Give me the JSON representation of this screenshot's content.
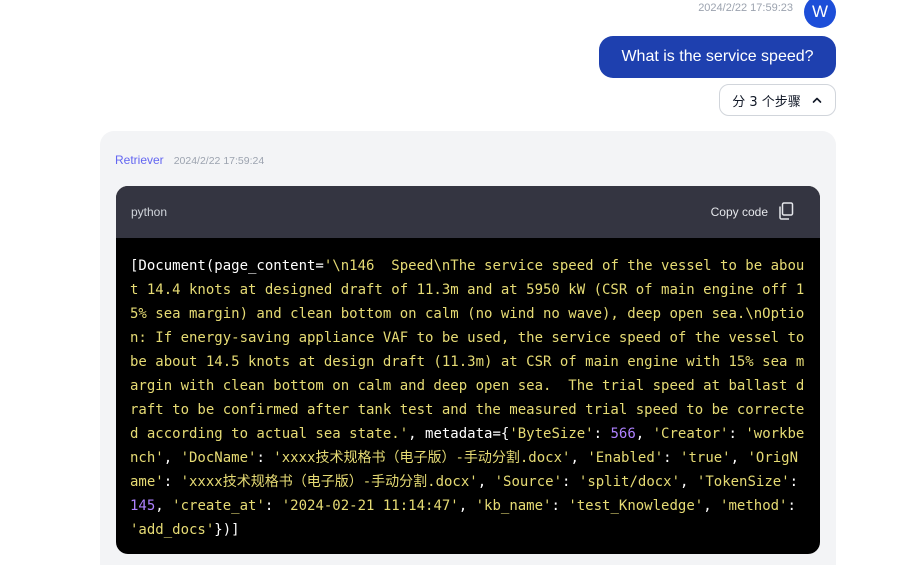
{
  "user_message": {
    "timestamp": "2024/2/22 17:59:23",
    "avatar_letter": "W",
    "text": "What is the service speed?",
    "steps_label": "分 3 个步骤"
  },
  "retriever": {
    "label": "Retriever",
    "timestamp": "2024/2/22 17:59:24",
    "code": {
      "language": "python",
      "copy_label": "Copy code",
      "tokens": [
        {
          "t": "plain",
          "v": "[Document(page_content="
        },
        {
          "t": "str",
          "v": "'\\n146  Speed\\nThe service speed of the vessel to be about 14.4 knots at designed draft of 11.3m and at 5950 kW (CSR of main engine off 15% sea margin) and clean bottom on calm (no wind no wave), deep open sea.\\nOption: If energy-saving appliance VAF to be used, the service speed of the vessel to be about 14.5 knots at design draft (11.3m) at CSR of main engine with 15% sea margin with clean bottom on calm and deep open sea.  The trial speed at ballast draft to be confirmed after tank test and the measured trial speed to be corrected according to actual sea state.'"
        },
        {
          "t": "plain",
          "v": ", metadata={"
        },
        {
          "t": "str",
          "v": "'ByteSize'"
        },
        {
          "t": "plain",
          "v": ": "
        },
        {
          "t": "num",
          "v": "566"
        },
        {
          "t": "plain",
          "v": ", "
        },
        {
          "t": "str",
          "v": "'Creator'"
        },
        {
          "t": "plain",
          "v": ": "
        },
        {
          "t": "str",
          "v": "'workbench'"
        },
        {
          "t": "plain",
          "v": ", "
        },
        {
          "t": "str",
          "v": "'DocName'"
        },
        {
          "t": "plain",
          "v": ": "
        },
        {
          "t": "str",
          "v": "'xxxx技术规格书（电子版）-手动分割.docx'"
        },
        {
          "t": "plain",
          "v": ", "
        },
        {
          "t": "str",
          "v": "'Enabled'"
        },
        {
          "t": "plain",
          "v": ": "
        },
        {
          "t": "str",
          "v": "'true'"
        },
        {
          "t": "plain",
          "v": ", "
        },
        {
          "t": "str",
          "v": "'OrigName'"
        },
        {
          "t": "plain",
          "v": ": "
        },
        {
          "t": "str",
          "v": "'xxxx技术规格书（电子版）-手动分割.docx'"
        },
        {
          "t": "plain",
          "v": ", "
        },
        {
          "t": "str",
          "v": "'Source'"
        },
        {
          "t": "plain",
          "v": ": "
        },
        {
          "t": "str",
          "v": "'split/docx'"
        },
        {
          "t": "plain",
          "v": ", "
        },
        {
          "t": "str",
          "v": "'TokenSize'"
        },
        {
          "t": "plain",
          "v": ": "
        },
        {
          "t": "num",
          "v": "145"
        },
        {
          "t": "plain",
          "v": ", "
        },
        {
          "t": "str",
          "v": "'create_at'"
        },
        {
          "t": "plain",
          "v": ": "
        },
        {
          "t": "str",
          "v": "'2024-02-21 11:14:47'"
        },
        {
          "t": "plain",
          "v": ", "
        },
        {
          "t": "str",
          "v": "'kb_name'"
        },
        {
          "t": "plain",
          "v": ": "
        },
        {
          "t": "str",
          "v": "'test_Knowledge'"
        },
        {
          "t": "plain",
          "v": ", "
        },
        {
          "t": "str",
          "v": "'method'"
        },
        {
          "t": "plain",
          "v": ": "
        },
        {
          "t": "str",
          "v": "'add_docs'"
        },
        {
          "t": "plain",
          "v": "})]"
        }
      ]
    }
  },
  "icons": {
    "steps_toggle": "chevron-up-icon",
    "copy": "copy-icon"
  },
  "colors": {
    "user_bubble": "#1e40af",
    "avatar": "#1d4ed8",
    "retriever_label": "#6366f1",
    "code_string": "#e6db74",
    "code_number": "#ae81ff"
  }
}
